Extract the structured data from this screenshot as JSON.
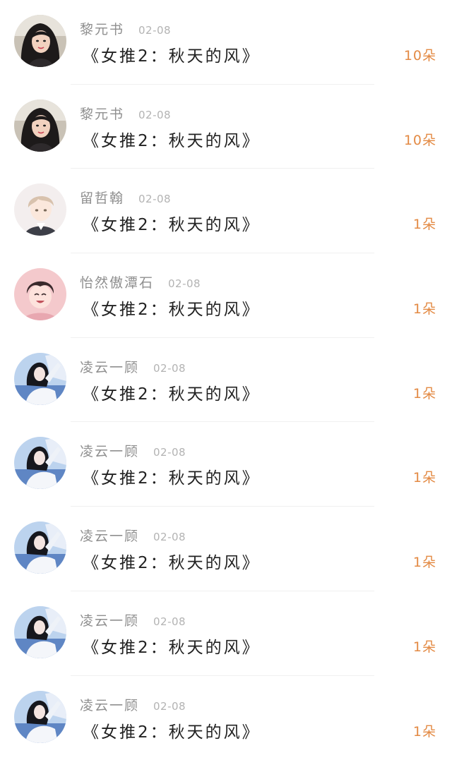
{
  "colors": {
    "name": "#8f8f8f",
    "date": "#b3b3b3",
    "title": "#222222",
    "gift": "#e38a44",
    "divider": "#f0f0f0"
  },
  "items": [
    {
      "name": "黎元书",
      "date": "02-08",
      "title": "《女推2：秋天的风》",
      "gift": "10朵",
      "avatar": "girl-dark-hair-photo-icon"
    },
    {
      "name": "黎元书",
      "date": "02-08",
      "title": "《女推2：秋天的风》",
      "gift": "10朵",
      "avatar": "girl-dark-hair-photo-icon"
    },
    {
      "name": "留哲翰",
      "date": "02-08",
      "title": "《女推2：秋天的风》",
      "gift": "1朵",
      "avatar": "anime-boy-light-hair-icon"
    },
    {
      "name": "怡然傲潭石",
      "date": "02-08",
      "title": "《女推2：秋天的风》",
      "gift": "1朵",
      "avatar": "anime-boy-pink-icon"
    },
    {
      "name": "凌云一顾",
      "date": "02-08",
      "title": "《女推2：秋天的风》",
      "gift": "1朵",
      "avatar": "girl-blue-white-photo-icon"
    },
    {
      "name": "凌云一顾",
      "date": "02-08",
      "title": "《女推2：秋天的风》",
      "gift": "1朵",
      "avatar": "girl-blue-white-photo-icon"
    },
    {
      "name": "凌云一顾",
      "date": "02-08",
      "title": "《女推2：秋天的风》",
      "gift": "1朵",
      "avatar": "girl-blue-white-photo-icon"
    },
    {
      "name": "凌云一顾",
      "date": "02-08",
      "title": "《女推2：秋天的风》",
      "gift": "1朵",
      "avatar": "girl-blue-white-photo-icon"
    },
    {
      "name": "凌云一顾",
      "date": "02-08",
      "title": "《女推2：秋天的风》",
      "gift": "1朵",
      "avatar": "girl-blue-white-photo-icon"
    }
  ]
}
